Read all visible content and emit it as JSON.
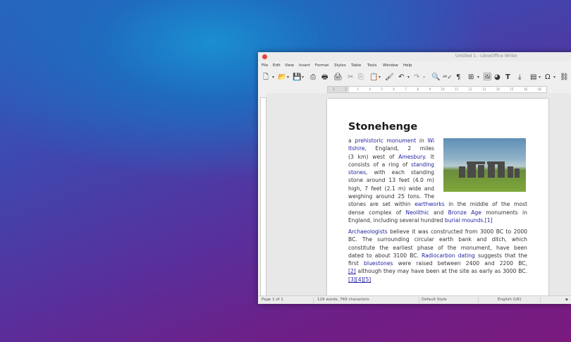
{
  "window": {
    "title": "Untitled 1 - LibreOffice Writer"
  },
  "menu": [
    "File",
    "Edit",
    "View",
    "Insert",
    "Format",
    "Styles",
    "Table",
    "Tools",
    "Window",
    "Help"
  ],
  "toolbar": {
    "icons": [
      "new-document-icon",
      "open-icon",
      "save-icon",
      "export-pdf-icon",
      "print-icon",
      "print-preview-icon",
      "cut-icon",
      "copy-icon",
      "paste-icon",
      "clone-formatting-icon",
      "undo-icon",
      "redo-icon",
      "find-replace-icon",
      "spelling-icon",
      "formatting-marks-icon",
      "insert-table-icon",
      "insert-image-icon",
      "insert-chart-icon",
      "insert-text-box-icon",
      "insert-page-break-icon",
      "insert-field-icon",
      "special-character-icon",
      "hyperlink-icon"
    ]
  },
  "document": {
    "heading": "Stonehenge",
    "para1": {
      "lines": [
        [
          "a ",
          "prehistoric monument",
          " in ",
          "Wi"
        ],
        [
          "ltshire",
          ", England, 2 miles"
        ],
        [
          "(3 km) west of ",
          "Amesbury",
          ". It"
        ],
        [
          "consists of a ring of ",
          "standing"
        ],
        [
          "stones",
          ", with each standing"
        ],
        [
          "stone around 13 feet (4.0 m)"
        ],
        [
          "high, 7 feet (2.1 m) wide and"
        ],
        [
          "weighing around 25 tons. The"
        ],
        [
          "stones are set within ",
          "earthworks",
          " in the middle of the most"
        ],
        [
          "dense complex of ",
          "Neolithic",
          " and ",
          "Bronze Age",
          " monuments in"
        ],
        [
          "England, including several hundred ",
          "burial mounds.[1]"
        ]
      ]
    },
    "para2": {
      "lines": [
        [
          "Archaeologists",
          " believe it was constructed from 3000 BC to 2000"
        ],
        [
          "BC. The surrounding circular earth bank and ditch, which"
        ],
        [
          "constitute the earliest phase of the monument, have been"
        ],
        [
          "dated to about 3100 BC. ",
          "Radiocarbon dating",
          " suggests that the"
        ],
        [
          "first ",
          "bluestones",
          " were raised between 2400 and 2200 BC,"
        ],
        [
          "[2]",
          " although they may have been at the site as early as 3000 BC."
        ],
        [
          "[3][4][5]"
        ]
      ]
    }
  },
  "status": {
    "page": "Page 1 of 1",
    "words": "129 words, 769 characters",
    "style": "Default Style",
    "language": "English (UK)"
  },
  "colors": {
    "link": "#1e1e9e",
    "close_button": "#e2473e"
  }
}
